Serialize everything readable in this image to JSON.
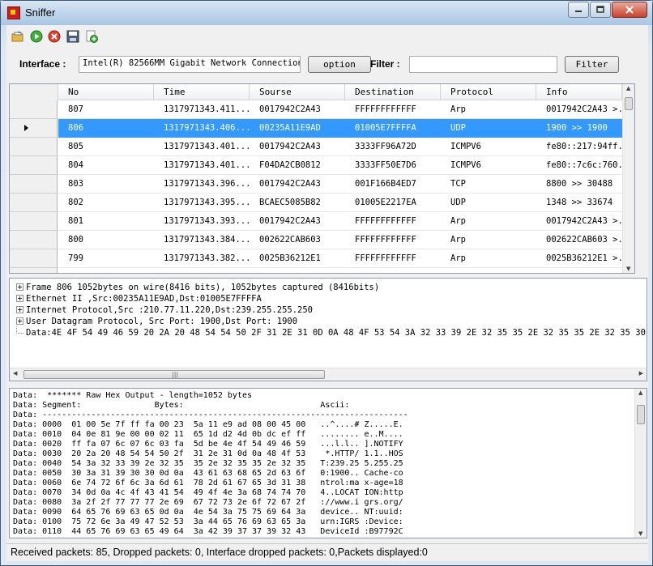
{
  "window": {
    "title": "Sniffer"
  },
  "toolbar": {
    "icons": [
      "open-icon",
      "start-icon",
      "stop-icon",
      "save-icon",
      "add-icon"
    ]
  },
  "interface": {
    "label": "Interface :",
    "value": "Intel(R) 82566MM Gigabit Network Connection",
    "option_label": "option",
    "filter_label": "Filter :",
    "filter_value": "",
    "filter_button": "Filter"
  },
  "grid": {
    "columns": [
      "No",
      "Time",
      "Sourse",
      "Destination",
      "Protocol",
      "Info"
    ],
    "rows": [
      [
        "807",
        "1317971343.411...",
        "0017942C2A43",
        "FFFFFFFFFFFF",
        "Arp",
        "0017942C2A43 >..."
      ],
      [
        "806",
        "1317971343.406...",
        "00235A11E9AD",
        "01005E7FFFFA",
        "UDP",
        "1900 >> 1900"
      ],
      [
        "805",
        "1317971343.401...",
        "0017942C2A43",
        "3333FF96A72D",
        "ICMPV6",
        "fe80::217:94ff..."
      ],
      [
        "804",
        "1317971343.401...",
        "F04DA2CB0812",
        "3333FF50E7D6",
        "ICMPV6",
        "fe80::7c6c:760..."
      ],
      [
        "803",
        "1317971343.396...",
        "0017942C2A43",
        "001F166B4ED7",
        "TCP",
        "8800 >> 30488"
      ],
      [
        "802",
        "1317971343.395...",
        "BCAEC5085B82",
        "01005E2217EA",
        "UDP",
        "1348 >> 33674"
      ],
      [
        "801",
        "1317971343.393...",
        "0017942C2A43",
        "FFFFFFFFFFFF",
        "Arp",
        "0017942C2A43 >..."
      ],
      [
        "800",
        "1317971343.384...",
        "002622CAB603",
        "FFFFFFFFFFFF",
        "Arp",
        "002622CAB603 >..."
      ],
      [
        "799",
        "1317971343.382...",
        "0025B36212E1",
        "FFFFFFFFFFFF",
        "Arp",
        "0025B36212E1 >..."
      ]
    ],
    "selected_no": "806"
  },
  "tree": {
    "nodes": [
      "Frame 806 1052bytes on wire(8416 bits), 1052bytes captured (8416bits)",
      "Ethernet II ,Src:00235A11E9AD,Dst:01005E7FFFFA",
      "Internet Protocol,Src :210.77.11.220,Dst:239.255.255.250",
      "User Datagram Protocol, Src Port: 1900,Dst Port: 1900"
    ],
    "data_line": "Data:4E 4F 54 49 46 59 20 2A 20 48 54 54 50 2F 31 2E 31 0D 0A 48 4F 53 54 3A 32 33 39 2E 32 35 35 2E 32 35 35 2E 32 35 30 3A 31"
  },
  "hex": {
    "lines": [
      "Data:  ******* Raw Hex Output - length=1052 bytes",
      "Data: Segment:               Bytes:                            Ascii:",
      "Data: ---------------------------------------------------------------------------",
      "Data: 0000  01 00 5e 7f ff fa 00 23  5a 11 e9 ad 08 00 45 00   ..^....# Z.....E.",
      "Data: 0010  04 0e 81 9e 00 00 02 11  65 1d d2 4d 0b dc ef ff   ........ e..M....",
      "Data: 0020  ff fa 07 6c 07 6c 03 fa  5d be 4e 4f 54 49 46 59   ...l.l.. ].NOTIFY",
      "Data: 0030  20 2a 20 48 54 54 50 2f  31 2e 31 0d 0a 48 4f 53    *.HTTP/ 1.1..HOS",
      "Data: 0040  54 3a 32 33 39 2e 32 35  35 2e 32 35 35 2e 32 35   T:239.25 5.255.25",
      "Data: 0050  30 3a 31 39 30 30 0d 0a  43 61 63 68 65 2d 63 6f   0:1900.. Cache-co",
      "Data: 0060  6e 74 72 6f 6c 3a 6d 61  78 2d 61 67 65 3d 31 38   ntrol:ma x-age=18",
      "Data: 0070  34 0d 0a 4c 4f 43 41 54  49 4f 4e 3a 68 74 74 70   4..LOCAT ION:http",
      "Data: 0080  3a 2f 2f 77 77 77 2e 69  67 72 73 2e 6f 72 67 2f   ://www.i grs.org/",
      "Data: 0090  64 65 76 69 63 65 0d 0a  4e 54 3a 75 75 69 64 3a   device.. NT:uuid:",
      "Data: 0100  75 72 6e 3a 49 47 52 53  3a 44 65 76 69 63 65 3a   urn:IGRS :Device:",
      "Data: 0110  44 65 76 69 63 65 49 64  3a 42 39 37 37 39 32 43   DeviceId :B97792C"
    ]
  },
  "status": {
    "text": "Received packets: 85, Dropped packets: 0, Interface dropped packets: 0,Packets displayed:0"
  }
}
